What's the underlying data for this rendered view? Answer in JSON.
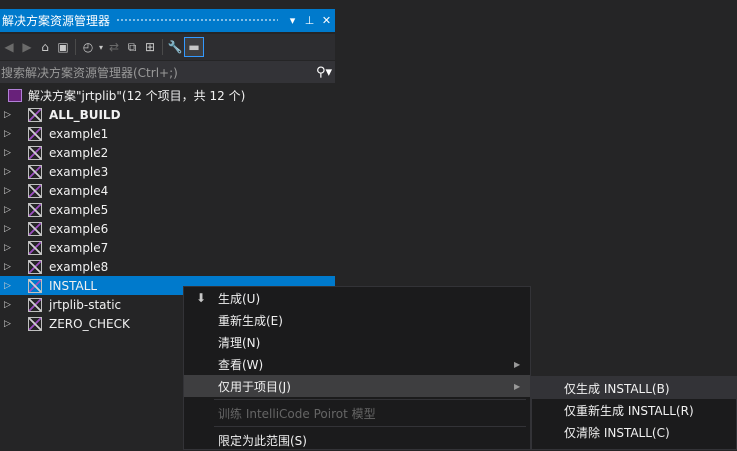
{
  "panel": {
    "title": "解决方案资源管理器",
    "window_buttons": [
      "▾",
      "⊥",
      "✕"
    ]
  },
  "search": {
    "placeholder": "搜索解决方案资源管理器(Ctrl+;)"
  },
  "tree": {
    "root_label": "解决方案\"jrtplib\"(12 个项目，共 12 个)",
    "items": [
      {
        "label": "ALL_BUILD",
        "bold": true
      },
      {
        "label": "example1"
      },
      {
        "label": "example2"
      },
      {
        "label": "example3"
      },
      {
        "label": "example4"
      },
      {
        "label": "example5"
      },
      {
        "label": "example6"
      },
      {
        "label": "example7"
      },
      {
        "label": "example8"
      },
      {
        "label": "INSTALL",
        "selected": true
      },
      {
        "label": "jrtplib-static"
      },
      {
        "label": "ZERO_CHECK"
      }
    ]
  },
  "context_menu": {
    "items": [
      {
        "label": "生成(U)",
        "icon": "build-icon"
      },
      {
        "label": "重新生成(E)"
      },
      {
        "label": "清理(N)"
      },
      {
        "label": "查看(W)",
        "submenu": true
      },
      {
        "label": "仅用于项目(J)",
        "submenu": true,
        "highlighted": true
      },
      {
        "label": "训练 IntelliCode Poirot 模型",
        "disabled": true
      },
      {
        "label": "限定为此范围(S)"
      }
    ]
  },
  "submenu": {
    "items": [
      {
        "label": "仅生成 INSTALL(B)"
      },
      {
        "label": "仅重新生成 INSTALL(R)"
      },
      {
        "label": "仅清除 INSTALL(C)"
      }
    ]
  },
  "colors": {
    "accent": "#007acc",
    "background": "#252526",
    "menu_bg": "#1b1b1c"
  }
}
